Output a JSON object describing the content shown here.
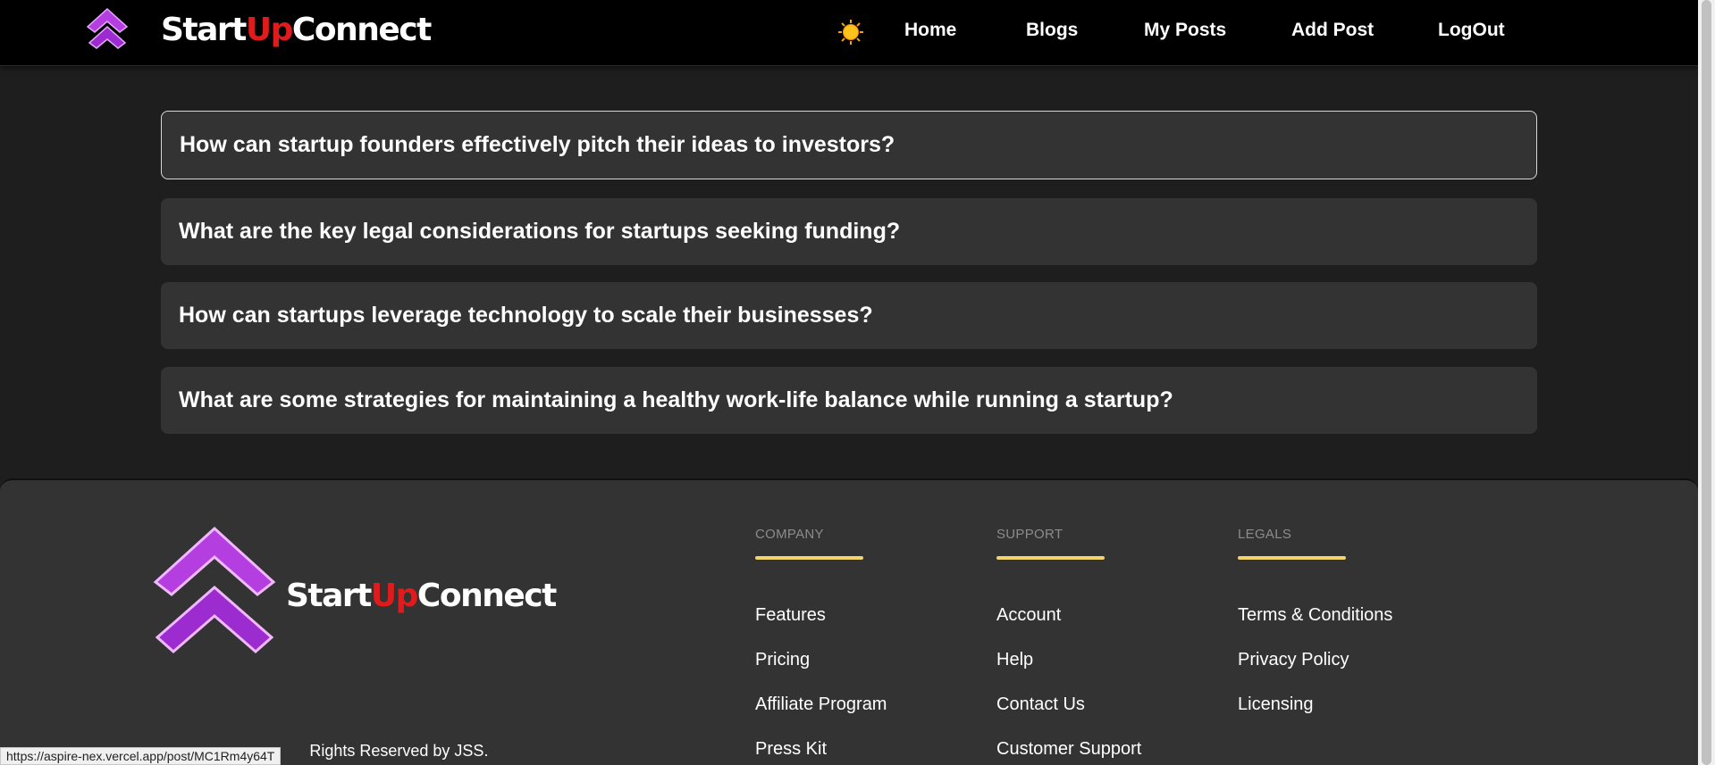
{
  "nav": {
    "brand_start": "Start",
    "brand_up": "Up",
    "brand_connect": "Connect",
    "logo_icon": "double-chevron-up-icon",
    "theme_icon": "sun-icon",
    "links": [
      "Home",
      "Blogs",
      "My Posts",
      "Add Post",
      "LogOut"
    ]
  },
  "faq": {
    "items": [
      "How can startup founders effectively pitch their ideas to investors?",
      "What are the key legal considerations for startups seeking funding?",
      "How can startups leverage technology to scale their businesses?",
      "What are some strategies for maintaining a healthy work-life balance while running a startup?"
    ]
  },
  "footer": {
    "brand_start": "Start",
    "brand_up": "Up",
    "brand_connect": "Connect",
    "copyright": "Rights Reserved by JSS.",
    "columns": [
      {
        "heading": "COMPANY",
        "links": [
          "Features",
          "Pricing",
          "Affiliate Program",
          "Press Kit"
        ]
      },
      {
        "heading": "SUPPORT",
        "links": [
          "Account",
          "Help",
          "Contact Us",
          "Customer Support"
        ]
      },
      {
        "heading": "LEGALS",
        "links": [
          "Terms & Conditions",
          "Privacy Policy",
          "Licensing"
        ]
      }
    ]
  },
  "status_bar": {
    "url": "https://aspire-nex.vercel.app/post/MC1Rm4y64T"
  },
  "colors": {
    "brand_red": "#e01b1b",
    "accent_yellow": "#f2d46b",
    "logo_purple": "#b43ee0",
    "card_bg": "#333333",
    "page_bg": "#1e1e1e"
  }
}
